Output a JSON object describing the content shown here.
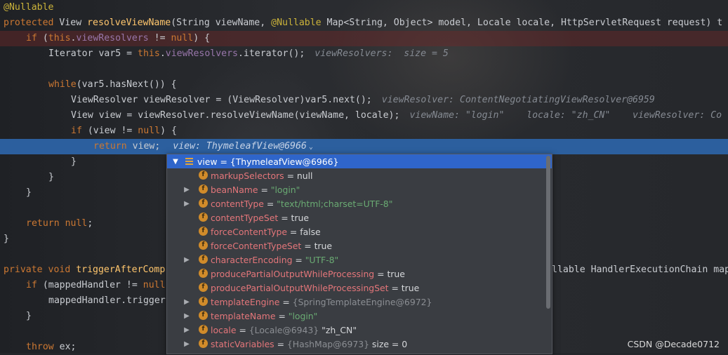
{
  "code_lines": {
    "l1": {
      "ann": "@Nullable"
    },
    "l2": {
      "kw1": "protected",
      "t1": " View ",
      "fn": "resolveViewName",
      "t2": "(String viewName, ",
      "ann": "@Nullable",
      "t3": " Map<String, Object> model, Locale locale, HttpServletRequest request) t"
    },
    "l3": {
      "kw": "if",
      "t1": " (",
      "kw2": "this",
      "t2": ".",
      "fld": "viewResolvers",
      "t3": " != ",
      "kw3": "null",
      "t4": ") {"
    },
    "l4": {
      "t1": "Iterator var5 = ",
      "kw": "this",
      "t2": ".",
      "fld": "viewResolvers",
      "t3": ".iterator();",
      "hint": "viewResolvers:  size = 5"
    },
    "l6": {
      "kw": "while",
      "t1": "(var5.hasNext()) {"
    },
    "l7": {
      "t1": "ViewResolver viewResolver = (ViewResolver)var5.next();",
      "hint": "viewResolver: ContentNegotiatingViewResolver@6959"
    },
    "l8": {
      "t1": "View view = viewResolver.resolveViewName(viewName, locale);",
      "hint": "viewName: \"login\"    locale: \"zh_CN\"    viewResolver: Co"
    },
    "l9": {
      "kw": "if",
      "t1": " (view != ",
      "kw2": "null",
      "t2": ") {"
    },
    "l10": {
      "kw": "return",
      "t1": " view;",
      "hint": "view: ThymeleafView@6966"
    },
    "l11": {
      "t1": "}"
    },
    "l12": {
      "t1": "}"
    },
    "l13": {
      "t1": "}"
    },
    "l15": {
      "kw": "return",
      "t1": " ",
      "kw2": "null",
      "t2": ";"
    },
    "l16": {
      "t1": "}"
    },
    "l18": {
      "kw": "private void",
      "t1": " ",
      "fn": "triggerAfterComp",
      "right": "llable HandlerExecutionChain map"
    },
    "l19": {
      "kw": "if",
      "t1": " (mappedHandler != ",
      "kw2": "null"
    },
    "l20": {
      "t1": "mappedHandler.trigger"
    },
    "l21": {
      "t1": "}"
    },
    "l23": {
      "kw": "throw",
      "t1": " ex;"
    }
  },
  "popup": {
    "root": {
      "name": "view",
      "value": " = {ThymeleafView@6966}"
    },
    "fields": [
      {
        "name": "markupSelectors",
        "value": "null",
        "kind": "plain",
        "expand": false
      },
      {
        "name": "beanName",
        "value": "\"login\"",
        "kind": "str",
        "expand": true
      },
      {
        "name": "contentType",
        "value": "\"text/html;charset=UTF-8\"",
        "kind": "str",
        "expand": true
      },
      {
        "name": "contentTypeSet",
        "value": "true",
        "kind": "plain",
        "expand": false
      },
      {
        "name": "forceContentType",
        "value": "false",
        "kind": "plain",
        "expand": false
      },
      {
        "name": "forceContentTypeSet",
        "value": "true",
        "kind": "plain",
        "expand": false
      },
      {
        "name": "characterEncoding",
        "value": "\"UTF-8\"",
        "kind": "str",
        "expand": true
      },
      {
        "name": "producePartialOutputWhileProcessing",
        "value": "true",
        "kind": "plain",
        "expand": false
      },
      {
        "name": "producePartialOutputWhileProcessingSet",
        "value": "true",
        "kind": "plain",
        "expand": false
      },
      {
        "name": "templateEngine",
        "value": "{SpringTemplateEngine@6972}",
        "kind": "gray",
        "expand": true
      },
      {
        "name": "templateName",
        "value": "\"login\"",
        "kind": "str",
        "expand": true
      },
      {
        "name": "locale",
        "value": "{Locale@6943}",
        "extra": " \"zh_CN\"",
        "kind": "gray",
        "expand": true
      },
      {
        "name": "staticVariables",
        "value": "{HashMap@6973}",
        "extra": "  size = 0",
        "kind": "gray",
        "expand": true
      }
    ],
    "field_icon_letter": "f"
  },
  "watermark": "CSDN @Decade0712",
  "colors": {
    "accent": "#2f65ca",
    "keyword": "#cc7832",
    "annotation": "#cbb33a",
    "field": "#9876aa",
    "string": "#6aab73"
  }
}
